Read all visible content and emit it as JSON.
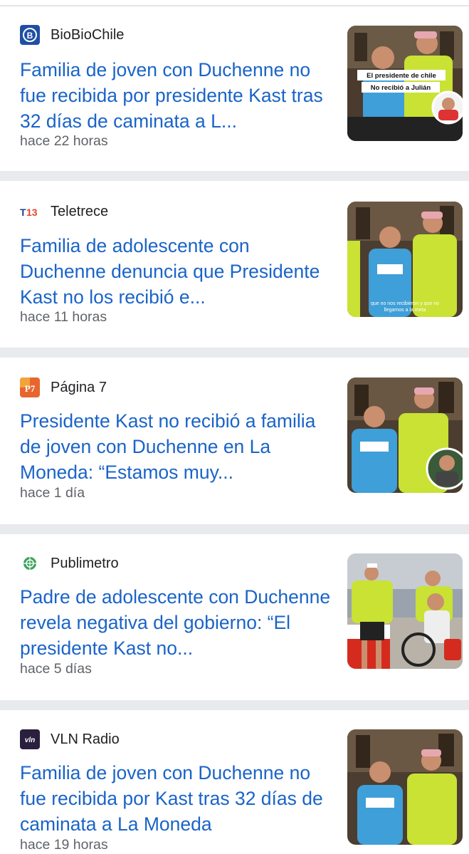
{
  "articles": [
    {
      "source": "BioBioChile",
      "headline": "Familia de joven con Duchenne no fue recibida por presidente Kast tras 32 días de caminata a L...",
      "time": "hace 22 horas",
      "thumb_caption_1": "El presidente de chile",
      "thumb_caption_2": "No recibió a Julián"
    },
    {
      "source": "Teletrece",
      "headline": "Familia de adolescente con Duchenne denuncia que Presidente Kast no los recibió e...",
      "time": "hace 11 horas",
      "thumb_caption_1": "que no nos recibieron y que no",
      "thumb_caption_2": "llegamos a la meta"
    },
    {
      "source": "Página 7",
      "headline": "Presidente Kast no recibió a familia de joven con Duchenne en La Moneda: “Estamos muy...",
      "time": "hace 1 día"
    },
    {
      "source": "Publimetro",
      "headline": "Padre de adolescente con Duchenne revela negativa del gobierno: “El presidente Kast no...",
      "time": "hace 5 días"
    },
    {
      "source": "VLN Radio",
      "headline": "Familia de joven con Duchenne no fue recibida por Kast tras 32 días de caminata a La Moneda",
      "time": "hace 19 horas"
    }
  ],
  "logos": {
    "biobio": "B",
    "t13": "T13",
    "p7": "P7",
    "vln": "vln"
  },
  "colors": {
    "headline": "#1a64c8",
    "source_text": "#202124",
    "time_text": "#5f6368",
    "separator": "#e8eaed"
  }
}
